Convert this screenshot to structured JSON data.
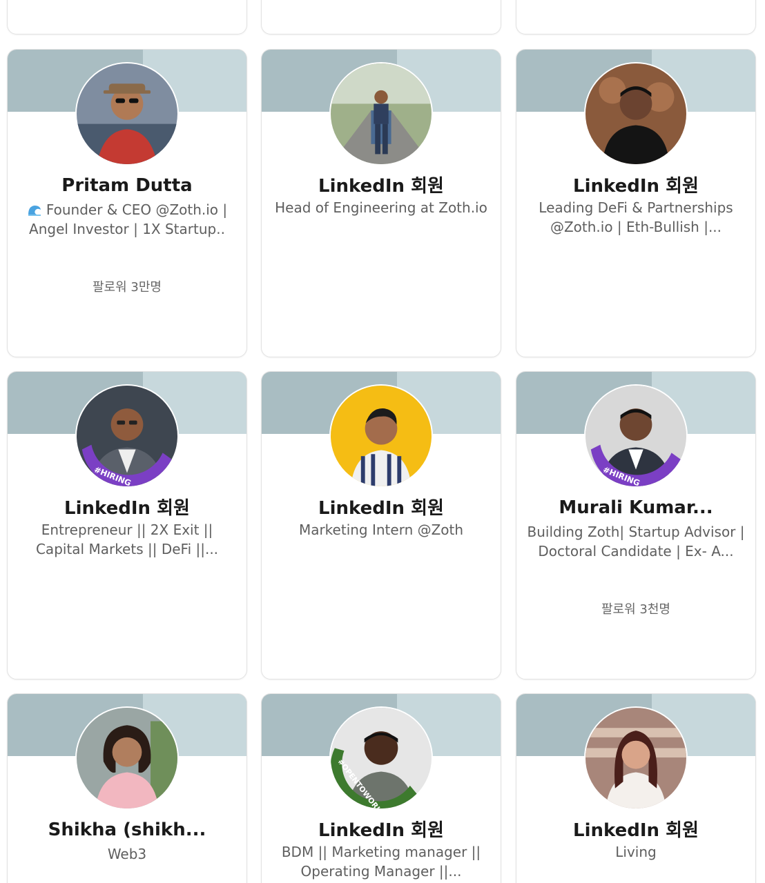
{
  "cards": [
    {
      "name": "Pritam Dutta",
      "headline_icon": "wave-icon",
      "headline": "Founder & CEO @Zoth.io | Angel Investor | 1X Startup..",
      "followers": "팔로워 3만명"
    },
    {
      "name": "LinkedIn 회원",
      "headline": "Head of Engineering at Zoth.io"
    },
    {
      "name": "LinkedIn 회원",
      "headline": "Leading DeFi & Partnerships @Zoth.io | Eth-Bullish |..."
    },
    {
      "name": "LinkedIn 회원",
      "headline": "Entrepreneur || 2X Exit || Capital Markets || DeFi ||...",
      "badge": "#HIRING"
    },
    {
      "name": "LinkedIn 회원",
      "headline": "Marketing Intern @Zoth"
    },
    {
      "name": "Murali Kumar...",
      "headline": "Building Zoth| Startup Advisor | Doctoral Candidate | Ex- A...",
      "followers": "팔로워 3천명",
      "badge": "#HIRING"
    },
    {
      "name": "Shikha (shikh...",
      "headline": "Web3"
    },
    {
      "name": "LinkedIn 회원",
      "headline": "BDM || Marketing manager || Operating Manager ||...",
      "badge": "#OPENTOWORK"
    },
    {
      "name": "LinkedIn 회원",
      "headline": "Living"
    }
  ],
  "colors": {
    "banner": "#a9bdc2",
    "hiring_badge": "#7b3fc4",
    "opentowork_badge": "#3d7a2e"
  }
}
